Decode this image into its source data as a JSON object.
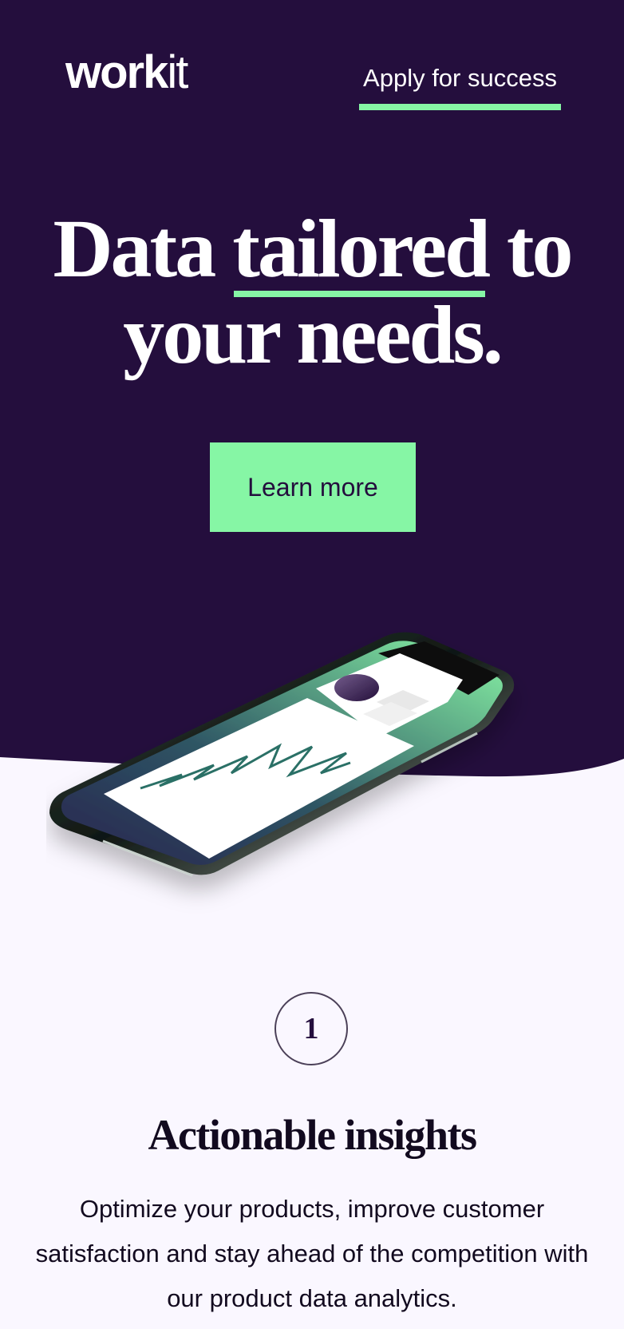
{
  "header": {
    "logo": {
      "bold": "work",
      "light": "it"
    },
    "cta_link": "Apply for success"
  },
  "hero": {
    "title": {
      "before": "Data ",
      "highlight": "tailored",
      "after": " to your needs."
    },
    "button": "Learn more",
    "image": "smartphone-analytics-illustration"
  },
  "feature": {
    "number": "1",
    "title": "Actionable insights",
    "body": "Optimize your products, improve customer satisfaction and stay ahead of the competition with our product data analytics."
  },
  "colors": {
    "hero_background": "#240E3D",
    "page_background": "#FAF7FF",
    "accent": "#86F6A5",
    "text_dark": "#120A1F",
    "white": "#FFFFFF"
  },
  "icons": {
    "phone": "phone-mockup",
    "chart": "line-chart",
    "avatar": "profile-circle"
  }
}
